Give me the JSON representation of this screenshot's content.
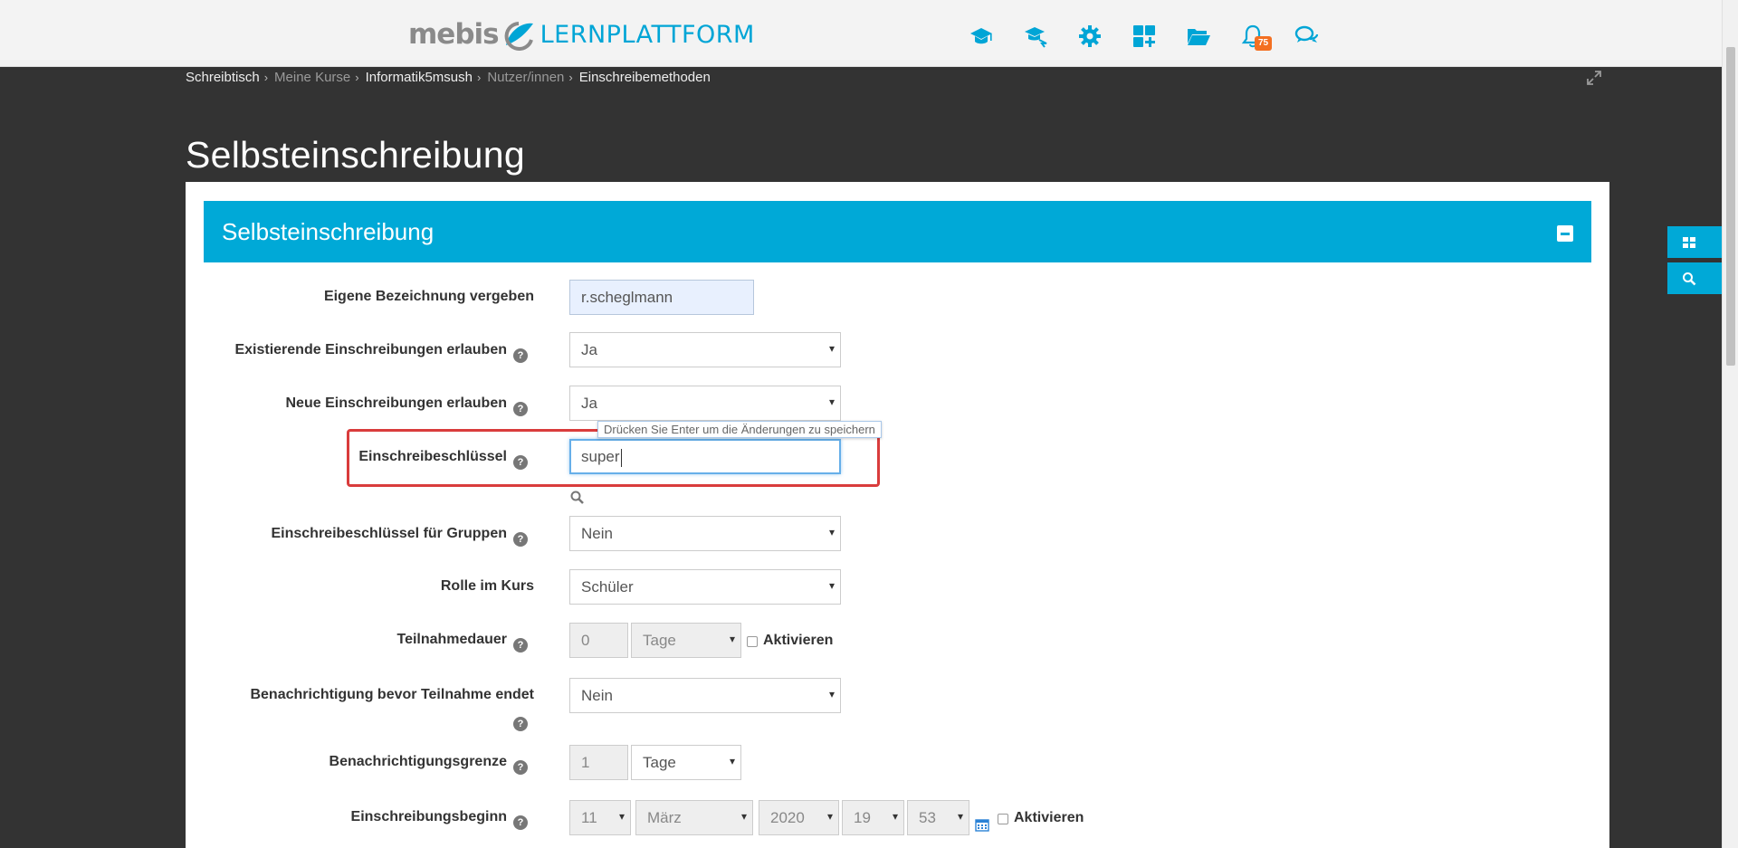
{
  "header": {
    "logo_mebis": "mebis",
    "logo_lernplattform": "LERNPLATTFORM",
    "notification_count": "75",
    "icons": [
      "graduation-cap-icon",
      "courses-icon",
      "gear-icon",
      "dashboard-add-icon",
      "folder-open-icon",
      "bell-icon",
      "chat-icon"
    ]
  },
  "breadcrumb": {
    "items": [
      "Schreibtisch",
      "Meine Kurse",
      "Informatik5msush",
      "Nutzer/innen",
      "Einschreibemethoden"
    ],
    "separator": "›"
  },
  "page": {
    "title": "Selbsteinschreibung"
  },
  "section": {
    "title": "Selbsteinschreibung"
  },
  "form": {
    "name_label": "Eigene Bezeichnung vergeben",
    "name_value": "r.scheglmann",
    "existing_label": "Existierende Einschreibungen erlauben",
    "existing_value": "Ja",
    "new_label": "Neue Einschreibungen erlauben",
    "new_value": "Ja",
    "key_label": "Einschreibeschlüssel",
    "key_value": "super",
    "key_tooltip": "Drücken Sie Enter um die Änderungen zu speichern",
    "group_key_label": "Einschreibeschlüssel für Gruppen",
    "group_key_value": "Nein",
    "role_label": "Rolle im Kurs",
    "role_value": "Schüler",
    "duration_label": "Teilnahmedauer",
    "duration_number": "0",
    "duration_unit": "Tage",
    "duration_enable": "Aktivieren",
    "notify_label": "Benachrichtigung bevor Teilnahme endet",
    "notify_value": "Nein",
    "threshold_label": "Benachrichtigungsgrenze",
    "threshold_number": "1",
    "threshold_unit": "Tage",
    "start_label": "Einschreibungsbeginn",
    "start_day": "11",
    "start_month": "März",
    "start_year": "2020",
    "start_hour": "19",
    "start_minute": "53",
    "start_enable": "Aktivieren"
  },
  "colors": {
    "accent": "#00a9d7",
    "badge": "#f36f21",
    "highlight": "#d93c3c",
    "background": "#333333"
  }
}
